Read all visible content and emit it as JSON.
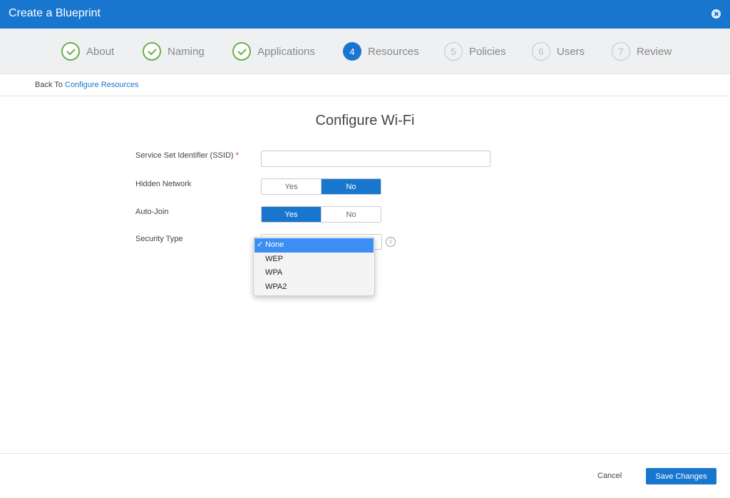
{
  "window": {
    "title": "Create a Blueprint",
    "close_icon": "close-circle-icon"
  },
  "steps": [
    {
      "number": "1",
      "label": "About",
      "state": "done"
    },
    {
      "number": "2",
      "label": "Naming",
      "state": "done"
    },
    {
      "number": "3",
      "label": "Applications",
      "state": "done"
    },
    {
      "number": "4",
      "label": "Resources",
      "state": "active"
    },
    {
      "number": "5",
      "label": "Policies",
      "state": "todo"
    },
    {
      "number": "6",
      "label": "Users",
      "state": "todo"
    },
    {
      "number": "7",
      "label": "Review",
      "state": "todo"
    }
  ],
  "breadcrumb": {
    "prefix": "Back To",
    "link": "Configure Resources"
  },
  "page_title": "Configure Wi-Fi",
  "form": {
    "ssid": {
      "label": "Service Set Identifier (SSID)",
      "required_mark": "*",
      "value": ""
    },
    "hidden_network": {
      "label": "Hidden Network",
      "options": [
        "Yes",
        "No"
      ],
      "selected": "No"
    },
    "auto_join": {
      "label": "Auto-Join",
      "options": [
        "Yes",
        "No"
      ],
      "selected": "Yes"
    },
    "security_type": {
      "label": "Security Type",
      "info_icon": "i",
      "options": [
        "None",
        "WEP",
        "WPA",
        "WPA2"
      ],
      "selected": "None",
      "check_mark": "✓"
    }
  },
  "footer": {
    "cancel_label": "Cancel",
    "save_label": "Save Changes"
  },
  "colors": {
    "primary": "#1976cf",
    "success": "#6ab04c",
    "dropdown_highlight": "#3d8ef2",
    "required": "#d0312d"
  }
}
